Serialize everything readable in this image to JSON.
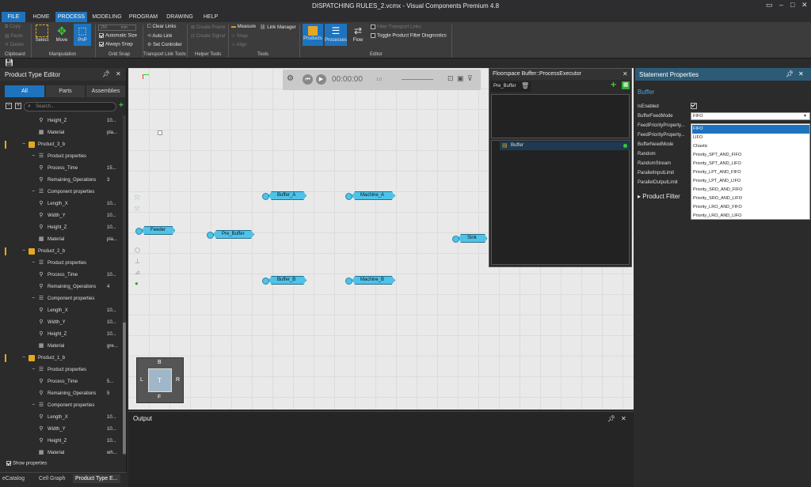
{
  "window": {
    "title": "DISPATCHING RULES_2.vcmx - Visual Components Premium 4.8"
  },
  "menu": {
    "tabs": [
      "FILE",
      "HOME",
      "PROCESS",
      "MODELING",
      "PROGRAM",
      "DRAWING",
      "HELP"
    ],
    "active": "PROCESS"
  },
  "ribbon": {
    "clipboard": {
      "copy": "Copy",
      "paste": "Paste",
      "delete": "Delete",
      "group": "Clipboard"
    },
    "manipulation": {
      "select": "Select",
      "move": "Move",
      "pnp": "PnP",
      "group": "Manipulation"
    },
    "grid_snap": {
      "size_value": "250",
      "size_unit": "mm",
      "automatic_size": "Automatic Size",
      "always_snap": "Always Snap",
      "group": "Grid Snap"
    },
    "transport_link": {
      "clear_links": "Clear Links",
      "auto_link": "Auto Link",
      "set_controller": "Set Controller",
      "group": "Transport Link Tools"
    },
    "helper_tools": {
      "create_frame": "Create Frame",
      "create_signal": "Create Signal",
      "group": "Helper Tools"
    },
    "tools": {
      "measure": "Measure",
      "link_manager": "Link Manager",
      "snap": "Snap",
      "align": "Align",
      "group": "Tools"
    },
    "editor": {
      "products": "Products",
      "processes": "Processes",
      "flow": "Flow",
      "filter_transport_links": "Filter Transport Links",
      "toggle_product_filter": "Toggle Product Filter Diagnostics",
      "group": "Editor"
    }
  },
  "left_panel": {
    "title": "Product Type Editor",
    "tabs": [
      "All",
      "Parts",
      "Assemblies"
    ],
    "search_placeholder": "Search...",
    "rows": [
      {
        "label": "Height_Z",
        "value": "10...",
        "indent": 60,
        "icon": "ruler"
      },
      {
        "label": "Material",
        "value": "pla...",
        "indent": 60,
        "icon": "grid"
      },
      {
        "label": "Product_3_b",
        "value": "",
        "indent": 48,
        "icon": "product",
        "top": true
      },
      {
        "label": "Product properties",
        "value": "",
        "indent": 60,
        "icon": "list",
        "minus": true
      },
      {
        "label": "Process_Time",
        "value": "15...",
        "indent": 60,
        "icon": "ruler"
      },
      {
        "label": "Remaining_Operations",
        "value": "3",
        "indent": 60,
        "icon": "ruler"
      },
      {
        "label": "Component properties",
        "value": "",
        "indent": 60,
        "icon": "list",
        "minus": true
      },
      {
        "label": "Length_X",
        "value": "10...",
        "indent": 60,
        "icon": "ruler"
      },
      {
        "label": "Width_Y",
        "value": "10...",
        "indent": 60,
        "icon": "ruler"
      },
      {
        "label": "Height_Z",
        "value": "10...",
        "indent": 60,
        "icon": "ruler"
      },
      {
        "label": "Material",
        "value": "pla...",
        "indent": 60,
        "icon": "grid"
      },
      {
        "label": "Product_2_b",
        "value": "",
        "indent": 48,
        "icon": "product",
        "top": true
      },
      {
        "label": "Product properties",
        "value": "",
        "indent": 60,
        "icon": "list",
        "minus": true
      },
      {
        "label": "Process_Time",
        "value": "10...",
        "indent": 60,
        "icon": "ruler"
      },
      {
        "label": "Remaining_Operations",
        "value": "4",
        "indent": 60,
        "icon": "ruler"
      },
      {
        "label": "Component properties",
        "value": "",
        "indent": 60,
        "icon": "list",
        "minus": true
      },
      {
        "label": "Length_X",
        "value": "10...",
        "indent": 60,
        "icon": "ruler"
      },
      {
        "label": "Width_Y",
        "value": "10...",
        "indent": 60,
        "icon": "ruler"
      },
      {
        "label": "Height_Z",
        "value": "10...",
        "indent": 60,
        "icon": "ruler"
      },
      {
        "label": "Material",
        "value": "gre...",
        "indent": 60,
        "icon": "grid"
      },
      {
        "label": "Product_1_b",
        "value": "",
        "indent": 48,
        "icon": "product",
        "top": true
      },
      {
        "label": "Product properties",
        "value": "",
        "indent": 60,
        "icon": "list",
        "minus": true
      },
      {
        "label": "Process_Time",
        "value": "5...",
        "indent": 60,
        "icon": "ruler"
      },
      {
        "label": "Remaining_Operations",
        "value": "5",
        "indent": 60,
        "icon": "ruler"
      },
      {
        "label": "Component properties",
        "value": "",
        "indent": 60,
        "icon": "list",
        "minus": true
      },
      {
        "label": "Length_X",
        "value": "10...",
        "indent": 60,
        "icon": "ruler"
      },
      {
        "label": "Width_Y",
        "value": "10...",
        "indent": 60,
        "icon": "ruler"
      },
      {
        "label": "Height_Z",
        "value": "10...",
        "indent": 60,
        "icon": "ruler"
      },
      {
        "label": "Material",
        "value": "wh...",
        "indent": 60,
        "icon": "grid"
      }
    ],
    "show_properties": "Show properties",
    "bottom_tabs": [
      "eCatalog",
      "Cell Graph",
      "Product Type E..."
    ]
  },
  "simulation": {
    "time": "00:00:00",
    "speed": "1.0"
  },
  "nodes": {
    "feeder": "Feeder",
    "pre_buffer": "Pre_Buffer",
    "buffer_a": "Buffer_A",
    "machine_a": "Machine_A",
    "buffer_b": "Buffer_B",
    "machine_b": "Machine_B",
    "sink": "Sink"
  },
  "navcube": {
    "top": "B",
    "left": "L",
    "center": "T",
    "right": "R",
    "bottom": "F"
  },
  "floorspace": {
    "title": "Floorspace Buffer::ProcessExecutor",
    "tab": "Pre_Buffer",
    "item": "Buffer"
  },
  "output": {
    "title": "Output"
  },
  "statement_properties": {
    "title": "Statement Properties",
    "section": "Buffer",
    "props": [
      "IsEnabled",
      "BufferFeedMode",
      "FeedPriorityProperty...",
      "FeedPriorityProperty...",
      "BufferNeedMode",
      "Random",
      "RandomStream",
      "ParallelInputLimit",
      "ParallelOutputLimit"
    ],
    "feed_mode_value": "FIFO",
    "options": [
      "FIFO",
      "LIFO",
      "Chaotic",
      "Priority_SPT_AND_FIFO",
      "Priority_SPT_AND_LIFO",
      "Priority_LPT_AND_FIFO",
      "Priority_LPT_AND_LIFO",
      "Priority_SRO_AND_FIFO",
      "Priority_SRO_AND_LIFO",
      "Priority_LRO_AND_FIFO",
      "Priority_LRO_AND_LIFO"
    ],
    "product_filter": "Product Filter"
  },
  "colors": {
    "accent": "#1e73be",
    "node": "#4ec3e8",
    "product": "#e5a823"
  }
}
